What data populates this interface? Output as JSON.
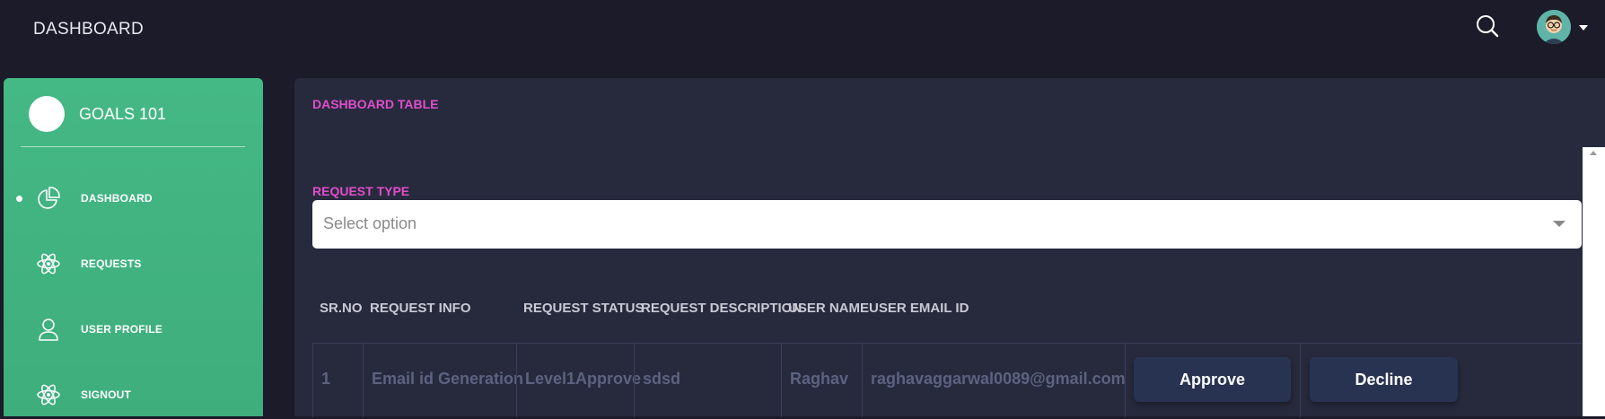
{
  "header": {
    "title": "DASHBOARD",
    "search_icon": "search-icon",
    "avatar_icon": "user-avatar"
  },
  "sidebar": {
    "brand": "GOALS 101",
    "accent": "#44b885",
    "items": [
      {
        "label": "DASHBOARD",
        "icon": "pie-chart-icon",
        "active": true
      },
      {
        "label": "REQUESTS",
        "icon": "atom-icon",
        "active": false
      },
      {
        "label": "USER PROFILE",
        "icon": "user-icon",
        "active": false
      },
      {
        "label": "SIGNOUT",
        "icon": "atom-icon",
        "active": false
      }
    ]
  },
  "main": {
    "title": "DASHBOARD TABLE",
    "title_color": "#e14eca",
    "filter": {
      "label": "REQUEST TYPE",
      "placeholder": "Select option"
    },
    "table": {
      "columns": [
        "SR.NO",
        "REQUEST INFO",
        "REQUEST STATUS",
        "REQUEST DESCRIPTION",
        "USER NAME",
        "USER EMAIL ID"
      ],
      "rows": [
        {
          "sr": "1",
          "info": "Email id Generation",
          "status": "Level1Approve",
          "description": "sdsd",
          "user": "Raghav",
          "email": "raghavaggarwal0089@gmail.com",
          "approve_label": "Approve",
          "decline_label": "Decline"
        }
      ]
    }
  }
}
